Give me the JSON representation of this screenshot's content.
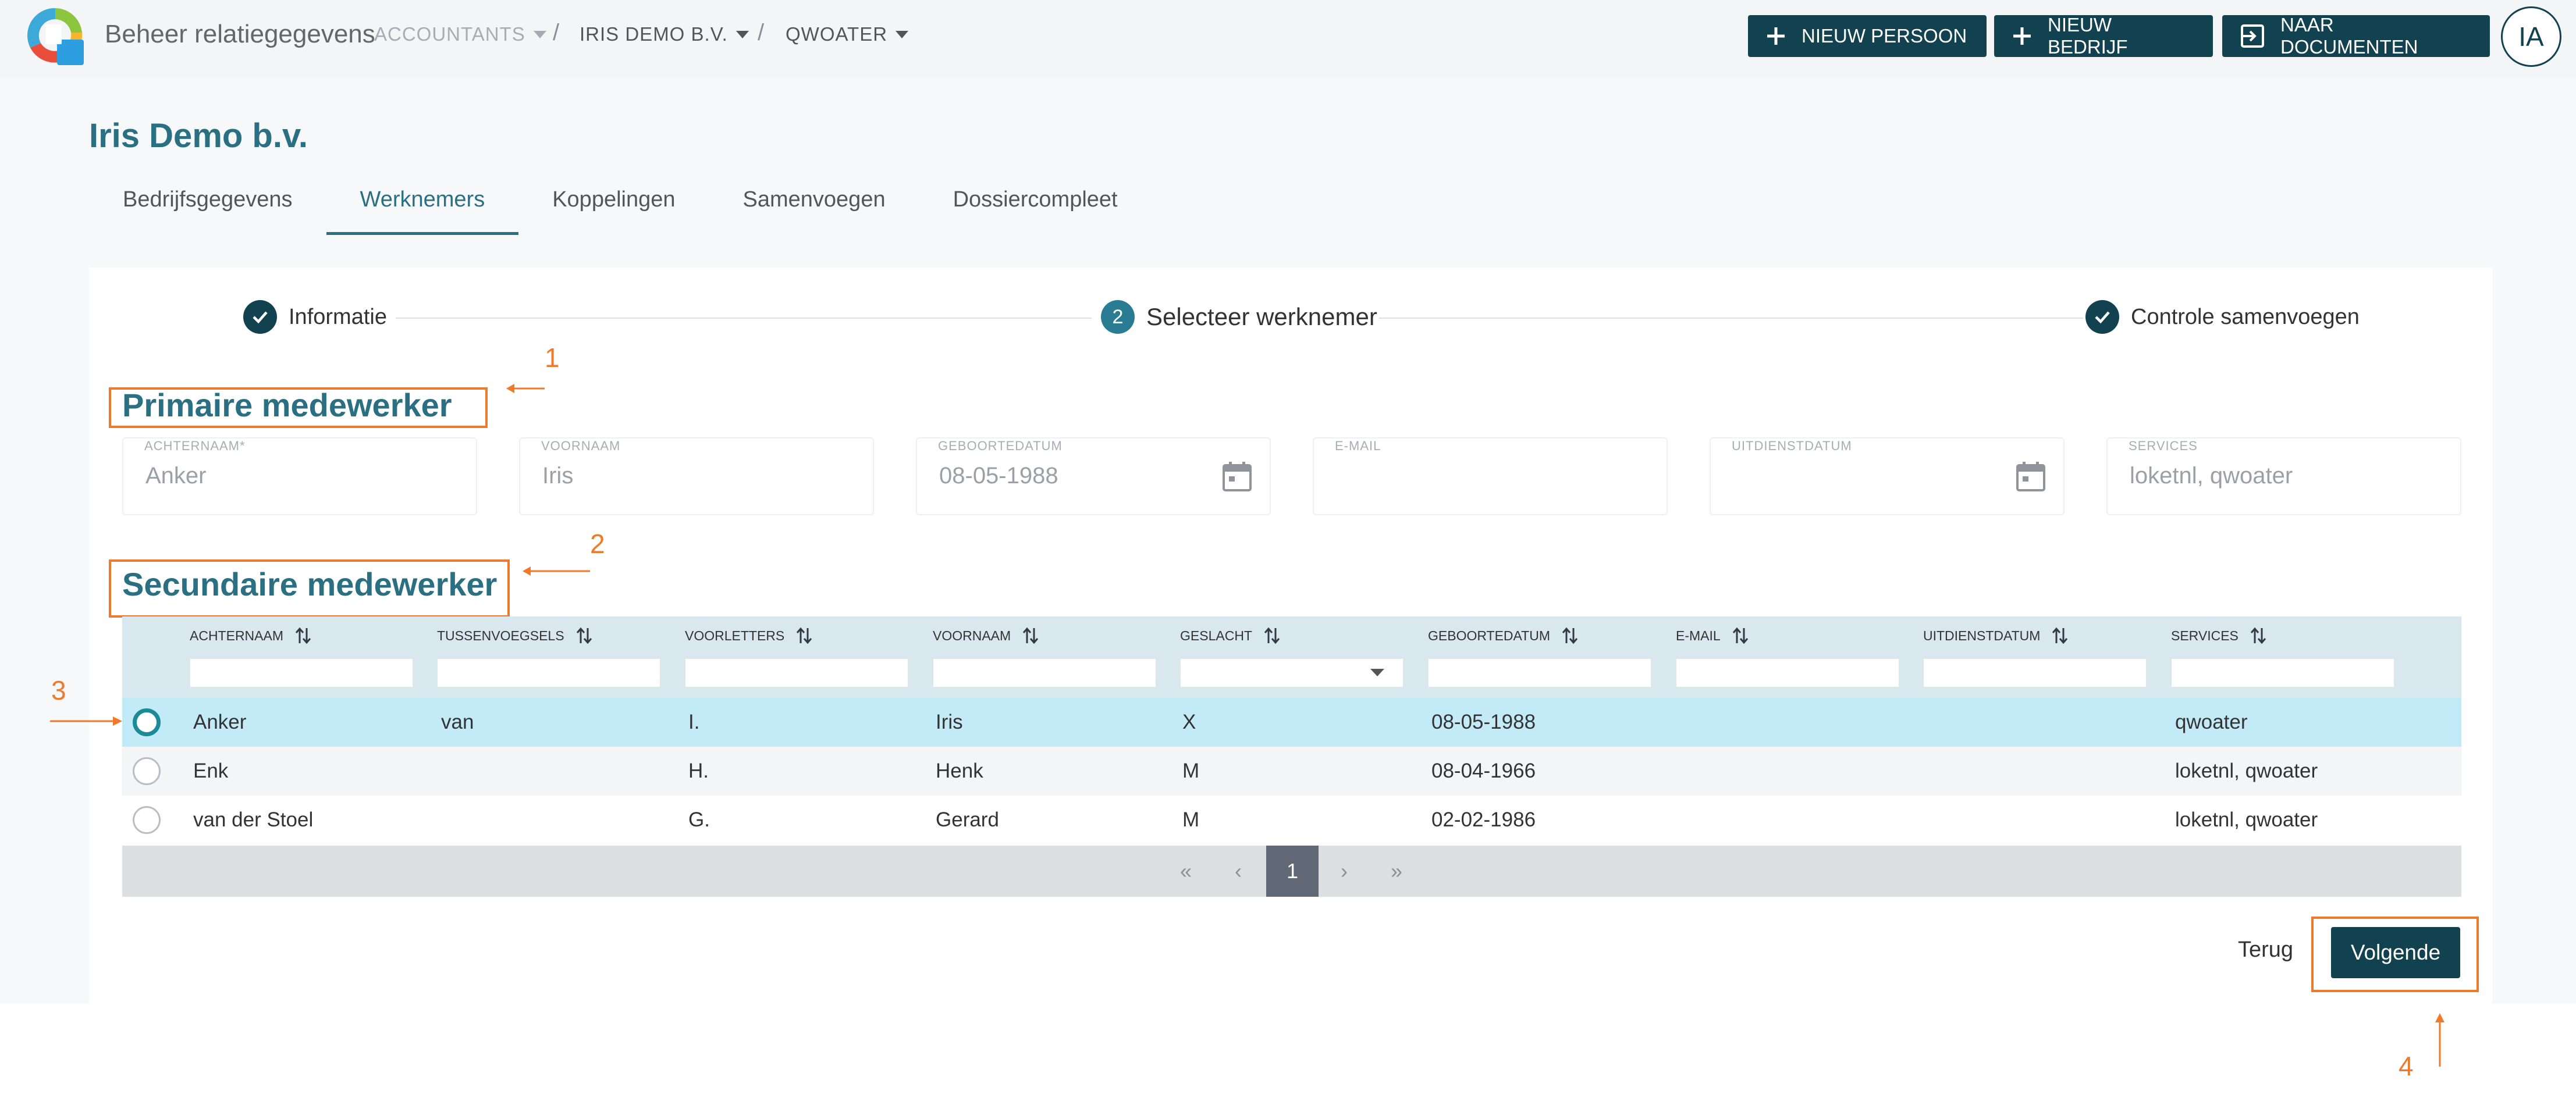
{
  "header": {
    "app_title": "Beheer relatiegegevens",
    "breadcrumbs": [
      "ACCOUNTANTS",
      "IRIS DEMO B.V.",
      "QWOATER"
    ],
    "buttons": {
      "new_person": "NIEUW PERSOON",
      "new_company": "NIEUW BEDRIJF",
      "to_documents": "NAAR DOCUMENTEN"
    },
    "avatar": "IA"
  },
  "company_name": "Iris Demo b.v.",
  "tabs": [
    {
      "label": "Bedrijfsgegevens",
      "active": false
    },
    {
      "label": "Werknemers",
      "active": true
    },
    {
      "label": "Koppelingen",
      "active": false
    },
    {
      "label": "Samenvoegen",
      "active": false
    },
    {
      "label": "Dossiercompleet",
      "active": false
    }
  ],
  "stepper": {
    "steps": [
      {
        "label": "Informatie",
        "state": "done",
        "marker": ""
      },
      {
        "label": "Selecteer werknemer",
        "state": "current",
        "marker": "2"
      },
      {
        "label": "Controle samenvoegen",
        "state": "done",
        "marker": ""
      }
    ]
  },
  "primary": {
    "title": "Primaire medewerker",
    "fields": [
      {
        "label": "ACHTERNAAM",
        "required": "*",
        "value": "Anker"
      },
      {
        "label": "VOORNAAM",
        "value": "Iris"
      },
      {
        "label": "GEBOORTEDATUM",
        "value": "08-05-1988",
        "icon": "calendar-icon"
      },
      {
        "label": "E-MAIL",
        "value": ""
      },
      {
        "label": "UITDIENSTDATUM",
        "value": "",
        "icon": "calendar-icon"
      },
      {
        "label": "SERVICES",
        "value": "loketnl, qwoater"
      }
    ]
  },
  "secondary": {
    "title": "Secundaire medewerker",
    "columns": [
      "ACHTERNAAM",
      "TUSSENVOEGSELS",
      "VOORLETTERS",
      "VOORNAAM",
      "GESLACHT",
      "GEBOORTEDATUM",
      "E-MAIL",
      "UITDIENSTDATUM",
      "SERVICES"
    ],
    "rows": [
      {
        "selected": true,
        "cells": [
          "Anker",
          "van",
          "I.",
          "Iris",
          "X",
          "08-05-1988",
          "",
          "",
          "qwoater"
        ]
      },
      {
        "selected": false,
        "cells": [
          "Enk",
          "",
          "H.",
          "Henk",
          "M",
          "08-04-1966",
          "",
          "",
          "loketnl, qwoater"
        ]
      },
      {
        "selected": false,
        "cells": [
          "van der Stoel",
          "",
          "G.",
          "Gerard",
          "M",
          "02-02-1986",
          "",
          "",
          "loketnl, qwoater"
        ]
      }
    ],
    "pagination": {
      "first": "«",
      "prev": "‹",
      "current": "1",
      "next": "›",
      "last": "»"
    }
  },
  "actions": {
    "back": "Terug",
    "next": "Volgende"
  },
  "annotations": [
    "1",
    "2",
    "3",
    "4"
  ],
  "colors": {
    "primary_dark": "#12414f",
    "accent_teal": "#2a6f82",
    "row_selected": "#c3ebf7",
    "row_alt": "#f4f5f7",
    "table_header": "#d9e7ee",
    "annotation": "#f07a2b"
  }
}
